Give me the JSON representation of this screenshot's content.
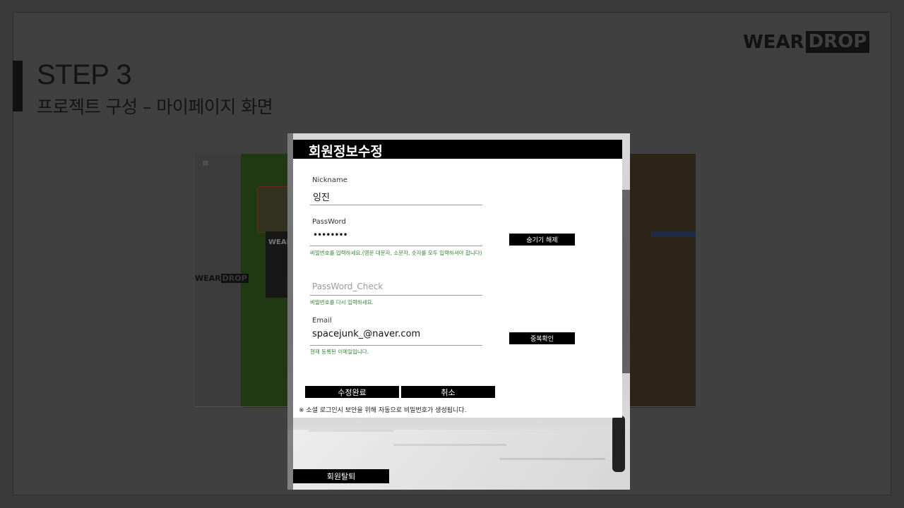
{
  "slide": {
    "step_title": "STEP 3",
    "step_subtitle": "프로젝트 구성 –  마이페이지 화면",
    "brand": {
      "wear": "WEAR",
      "drop": "DROP"
    }
  },
  "background_screenshot": {
    "menu_glyph": "≡",
    "mini_logo": {
      "wear": "WEAR",
      "drop": "DROP"
    },
    "card_text": "WEAR"
  },
  "form": {
    "title": "회원정보수정",
    "nickname": {
      "label": "Nickname",
      "value": "잉진"
    },
    "password": {
      "label": "PassWord",
      "value": "••••••••",
      "toggle_button": "숨기기 해제",
      "hint": "비밀번호를 입력하세요.(영문 대문자, 소문자, 숫자를 모두 입력하셔야 합니다)"
    },
    "password_check": {
      "placeholder": "PassWord_Check",
      "hint": "비밀번호를 다시 입력하세요."
    },
    "email": {
      "label": "Email",
      "value": "spacejunk_@naver.com",
      "check_button": "중복확인",
      "hint": "현재 등록된 이메일입니다."
    },
    "submit_button": "수정완료",
    "cancel_button": "취소",
    "note": "※ 소셜 로그인시 보안을 위해 자동으로 비밀번호가 생성됩니다."
  },
  "withdraw_button": "회원탈퇴",
  "colors": {
    "slide_bg": "#404040",
    "hint_green": "#2f8a2f",
    "button_black": "#000000"
  }
}
